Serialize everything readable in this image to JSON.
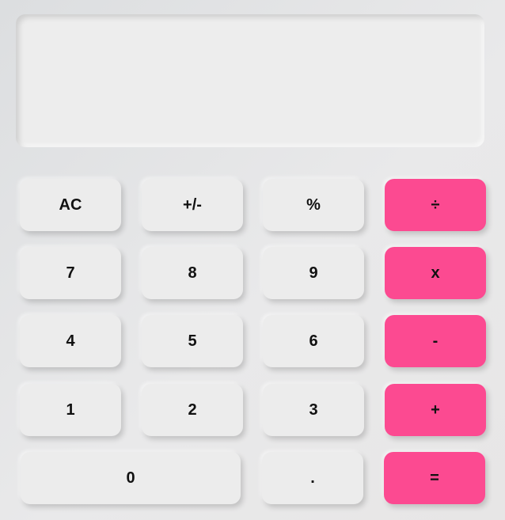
{
  "display": {
    "value": ""
  },
  "keys": {
    "ac": "AC",
    "sign": "+/-",
    "percent": "%",
    "divide": "÷",
    "seven": "7",
    "eight": "8",
    "nine": "9",
    "multiply": "x",
    "four": "4",
    "five": "5",
    "six": "6",
    "subtract": "-",
    "one": "1",
    "two": "2",
    "three": "3",
    "add": "+",
    "zero": "0",
    "decimal": ".",
    "equals": "="
  },
  "colors": {
    "operator": "#fc4a91",
    "key": "#ececec",
    "display": "#ededed",
    "body": "#e4e5e7"
  }
}
